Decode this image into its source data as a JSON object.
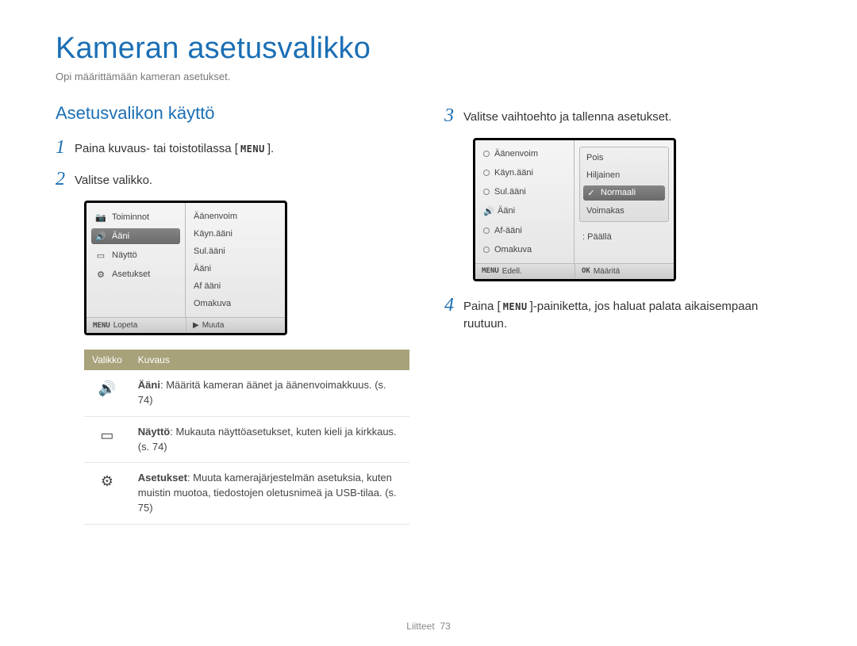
{
  "page": {
    "title": "Kameran asetusvalikko",
    "subtitle": "Opi määrittämään kameran asetukset."
  },
  "section_title": "Asetusvalikon käyttö",
  "menu_word": "MENU",
  "ok_word": "OK",
  "steps": {
    "s1_pre": "Paina kuvaus- tai toistotilassa [",
    "s1_post": "].",
    "s2": "Valitse valikko.",
    "s3": "Valitse vaihtoehto ja tallenna asetukset.",
    "s4_pre": "Paina [",
    "s4_post": "]-painiketta, jos haluat palata aikaisempaan ruutuun."
  },
  "screen1": {
    "left": [
      {
        "icon": "camera-icon",
        "label": "Toiminnot"
      },
      {
        "icon": "sound-icon",
        "label": "Ääni",
        "selected": true
      },
      {
        "icon": "display-icon",
        "label": "Näyttö"
      },
      {
        "icon": "gear-icon",
        "label": "Asetukset"
      }
    ],
    "right": [
      "Äänenvoim",
      "Käyn.ääni",
      "Sul.ääni",
      "Ääni",
      "Af ääni",
      "Omakuva"
    ],
    "footer_left": "Lopeta",
    "footer_right": "Muuta"
  },
  "screen2": {
    "left": [
      {
        "label": "Äänenvoim"
      },
      {
        "label": "Käyn.ääni"
      },
      {
        "label": "Sul.ääni"
      },
      {
        "label": "Ääni",
        "hasSound": true
      },
      {
        "label": "Af-ääni"
      },
      {
        "label": "Omakuva",
        "value": ": Päällä"
      }
    ],
    "right": [
      {
        "label": "Pois"
      },
      {
        "label": "Hiljainen"
      },
      {
        "label": "Normaali",
        "selected": true
      },
      {
        "label": "Voimakas"
      }
    ],
    "footer_left": "Edell.",
    "footer_right": "Määritä"
  },
  "table": {
    "head_menu": "Valikko",
    "head_desc": "Kuvaus",
    "rows": [
      {
        "icon": "sound-icon",
        "bold": "Ääni",
        "body": ": Määritä kameran äänet ja äänenvoimakkuus. (s. 74)"
      },
      {
        "icon": "display-icon",
        "bold": "Näyttö",
        "body": ": Mukauta näyttöasetukset, kuten kieli ja kirkkaus. (s. 74)"
      },
      {
        "icon": "gear-icon",
        "bold": "Asetukset",
        "body": ": Muuta kamerajärjestelmän asetuksia, kuten muistin muotoa, tiedostojen oletusnimeä ja USB-tilaa. (s. 75)"
      }
    ]
  },
  "footer": {
    "label": "Liitteet",
    "page": "73"
  },
  "glyphs": {
    "camera": "📷",
    "sound": "🔊",
    "display": "▭",
    "gear": "⚙",
    "play": "▶"
  }
}
